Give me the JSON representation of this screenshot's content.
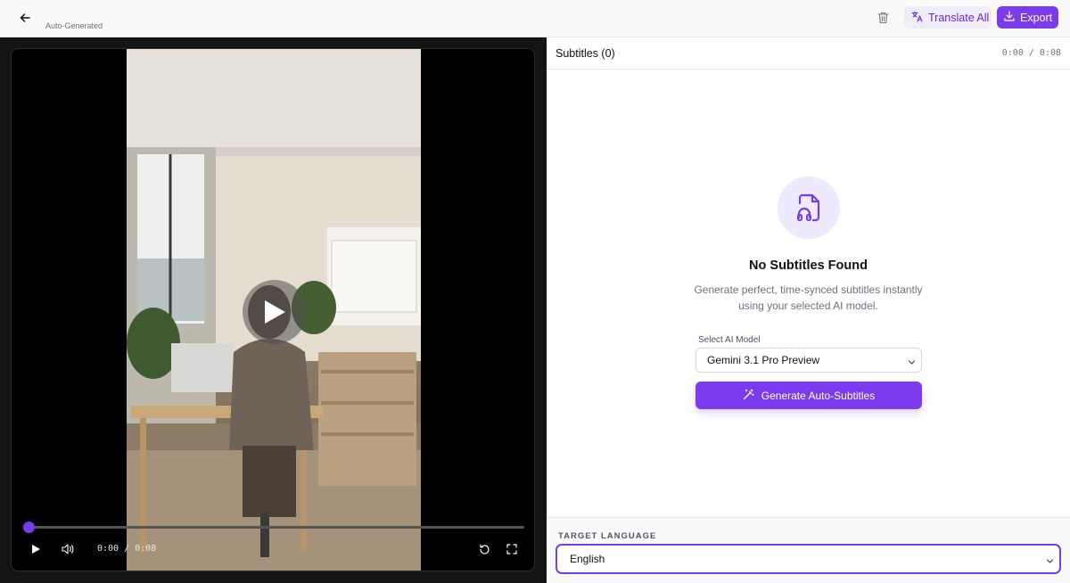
{
  "header": {
    "subtitle_tag": "Auto-Generated",
    "translate_label": "Translate All",
    "export_label": "Export"
  },
  "player": {
    "time": "0:00 / 0:08",
    "progress": 0
  },
  "panel": {
    "title": "Subtitles (0)",
    "time": "0:00 / 0:08"
  },
  "empty_state": {
    "title": "No Subtitles Found",
    "description": "Generate perfect, time-synced subtitles instantly using your selected AI model.",
    "model_label": "Select AI Model",
    "model_value": "Gemini 3.1 Pro Preview",
    "generate_label": "Generate Auto-Subtitles"
  },
  "target": {
    "label": "TARGET LANGUAGE",
    "value": "English"
  },
  "colors": {
    "accent": "#7c3aed",
    "accent_soft": "#ede9fe"
  }
}
